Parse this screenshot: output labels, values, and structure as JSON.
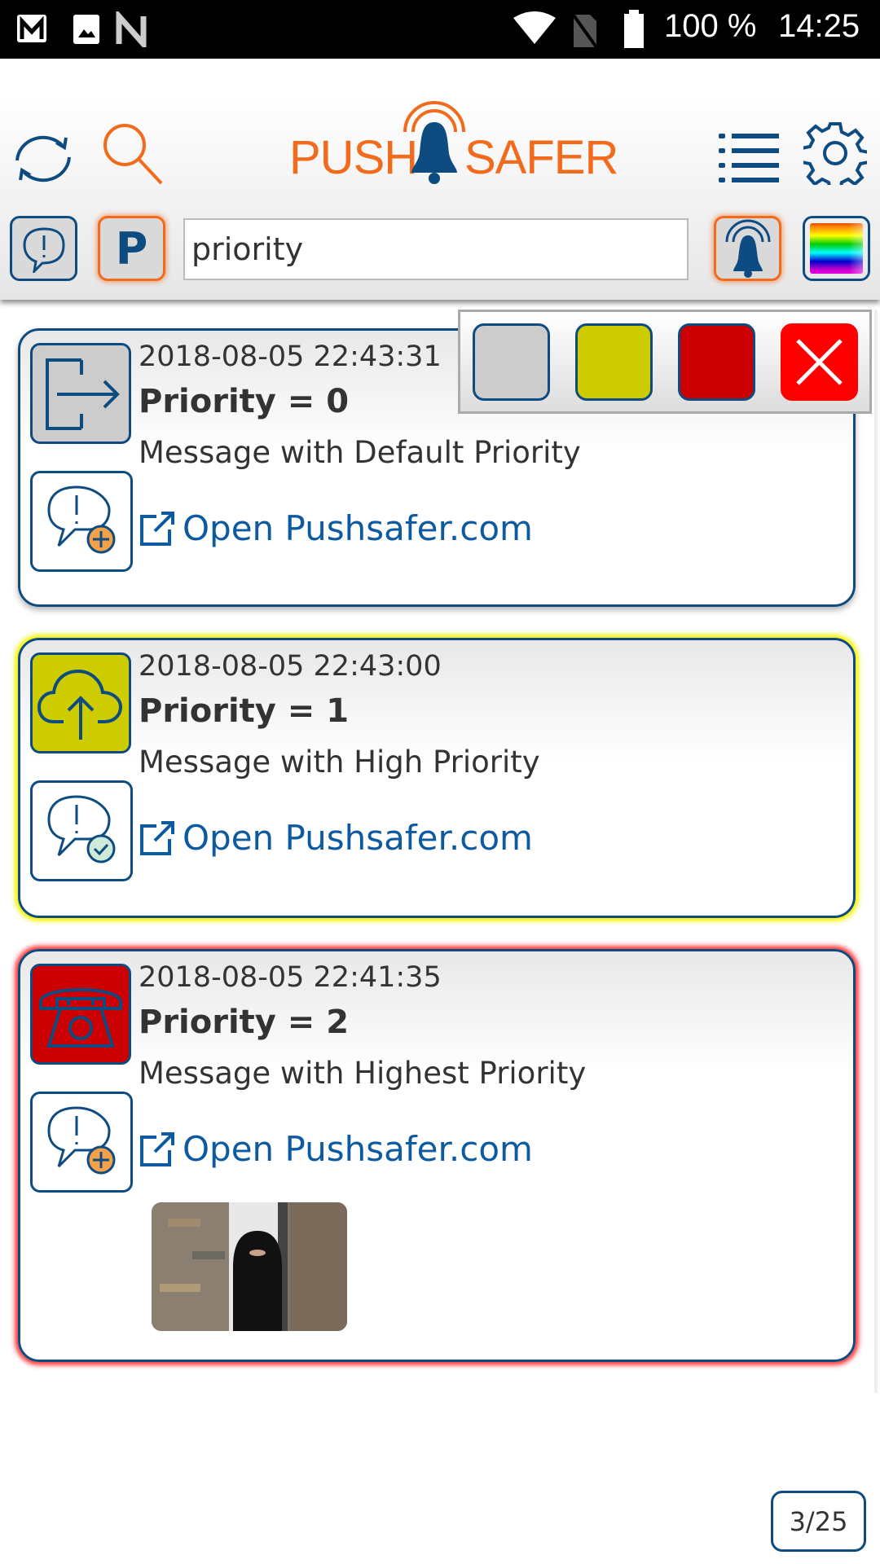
{
  "status_bar": {
    "battery": "100 %",
    "time": "14:25",
    "icons": [
      "gmail-icon",
      "gallery-icon",
      "n-icon",
      "wifi-icon",
      "no-sim-icon",
      "battery-icon"
    ]
  },
  "header": {
    "logo_left": "PUSH",
    "logo_right": "SAFER",
    "icons": [
      "refresh-icon",
      "search-icon",
      "list-icon",
      "gear-icon"
    ]
  },
  "toolbar": {
    "p_label": "P",
    "search_value": "priority",
    "search_placeholder": ""
  },
  "color_filter": {
    "swatches": [
      "#cccccc",
      "#cccc00",
      "#cc0000"
    ],
    "close_color": "#ff0000"
  },
  "messages": [
    {
      "date": "2018-08-05 22:43:31",
      "title": "Priority = 0",
      "message": "Message with Default Priority",
      "link": "Open Pushsafer.com",
      "color": "#cccccc",
      "icon": "exit-arrow-icon",
      "action_icon": "message-add-icon"
    },
    {
      "date": "2018-08-05 22:43:00",
      "title": "Priority = 1",
      "message": "Message with High Priority",
      "link": "Open Pushsafer.com",
      "color": "#cccc00",
      "icon": "cloud-upload-icon",
      "action_icon": "message-check-icon"
    },
    {
      "date": "2018-08-05 22:41:35",
      "title": "Priority = 2",
      "message": "Message with Highest Priority",
      "link": "Open Pushsafer.com",
      "color": "#cc0000",
      "icon": "telephone-icon",
      "action_icon": "message-add-icon"
    }
  ],
  "pager": {
    "label": "3/25"
  },
  "colors": {
    "brand_blue": "#0e4b80",
    "brand_orange": "#f26a1b",
    "link": "#0e5aa0"
  }
}
